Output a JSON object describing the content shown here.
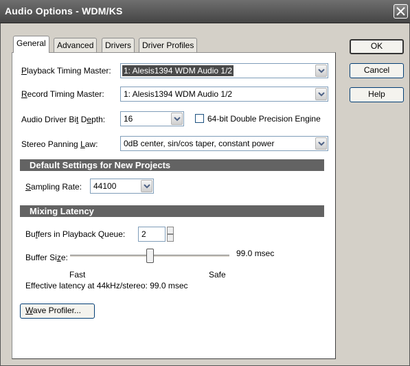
{
  "window": {
    "title": "Audio Options - WDM/KS"
  },
  "tabs": [
    {
      "label": "General"
    },
    {
      "label": "Advanced"
    },
    {
      "label": "Drivers"
    },
    {
      "label": "Driver Profiles"
    }
  ],
  "general": {
    "playback_timing": {
      "label_u": "P",
      "label_rest": "layback Timing Master:",
      "value": "1: Alesis1394 WDM Audio 1/2"
    },
    "record_timing": {
      "label_u": "R",
      "label_rest": "ecord Timing Master:",
      "value": "1: Alesis1394 WDM Audio 1/2"
    },
    "bit_depth": {
      "label_pre": "Audio Driver Bi",
      "label_u": "t",
      "label_mid": " D",
      "label_u2": "e",
      "label_rest": "pth:",
      "value": "16"
    },
    "double_precision": {
      "label": "64-bit Double Precision Engine",
      "checked": false
    },
    "panning_law": {
      "label_pre": "Stereo Panning ",
      "label_u": "L",
      "label_rest": "aw:",
      "value": "0dB center, sin/cos taper, constant power"
    }
  },
  "default_settings": {
    "header": "Default Settings for New Projects",
    "sampling_rate": {
      "label_u": "S",
      "label_rest": "ampling Rate:",
      "value": "44100"
    }
  },
  "mixing_latency": {
    "header": "Mixing Latency",
    "buffers": {
      "label_pre": "Bu",
      "label_u": "f",
      "label_rest": "fers in Playback Queue:",
      "value": "2"
    },
    "buffer_size": {
      "label_pre": "Buffer Si",
      "label_u": "z",
      "label_rest": "e:",
      "readout": "99.0 msec",
      "level": 0.5
    },
    "fast_label": "Fast",
    "safe_label": "Safe",
    "effective": "Effective latency at 44kHz/stereo:  99.0 msec"
  },
  "wave_profiler": {
    "label_u": "W",
    "label_rest": "ave Profiler..."
  },
  "buttons": {
    "ok": "OK",
    "cancel": "Cancel",
    "help": "Help"
  }
}
